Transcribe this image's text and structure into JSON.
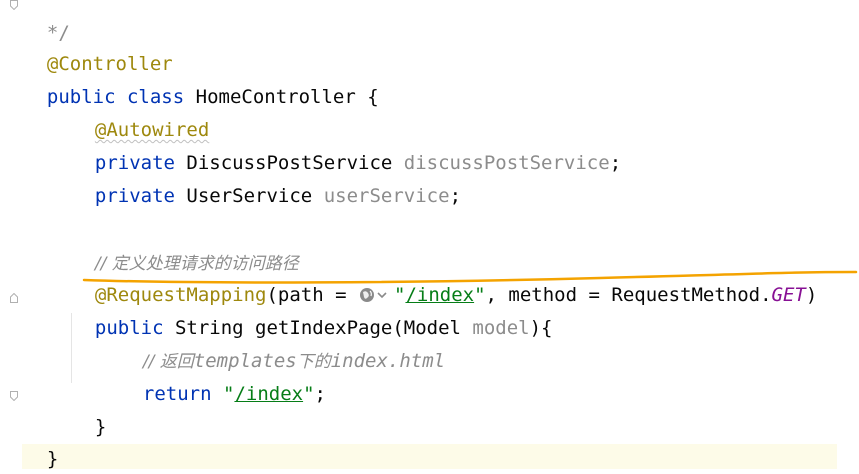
{
  "editor": {
    "lines": {
      "l0": "*/",
      "l1_ann": "@Controller",
      "l2_kw1": "public",
      "l2_kw2": "class",
      "l2_name": "HomeController {",
      "l3_ann": "@Autowired",
      "l4_kw": "private",
      "l4_type": "DiscussPostService",
      "l4_field": "discussPostService",
      "l4_end": ";",
      "l5_kw": "private",
      "l5_type": "UserService",
      "l5_field": "userService",
      "l5_end": ";",
      "l7_cmt": "// 定义处理请求的访问路径",
      "l8_ann": "@RequestMapping",
      "l8_open": "(path = ",
      "l8_str_q1": "\"",
      "l8_str": "/index",
      "l8_str_q2": "\"",
      "l8_mid": ", method = RequestMethod.",
      "l8_const": "GET",
      "l8_close": ")",
      "l9_kw": "public",
      "l9_rest": "String getIndexPage(Model ",
      "l9_param": "model",
      "l9_end": "){",
      "l10_cmt_a": "// 返回",
      "l10_cmt_b": "templates",
      "l10_cmt_c": "下的",
      "l10_cmt_d": "index.html",
      "l11_kw": "return",
      "l11_q1": "\"",
      "l11_str": "/index",
      "l11_q2": "\"",
      "l11_end": ";",
      "l12": "}",
      "l13": "}"
    }
  },
  "icons": {
    "web_link": "globe-icon",
    "web_link_dropdown": "chevron-down-icon",
    "fold": "fold-marker-icon"
  },
  "colors": {
    "keyword": "#0033b3",
    "annotation": "#9e880d",
    "field": "#871094",
    "comment": "#8c8c8c",
    "string": "#067d17",
    "highlight_stroke": "#f4a300"
  }
}
